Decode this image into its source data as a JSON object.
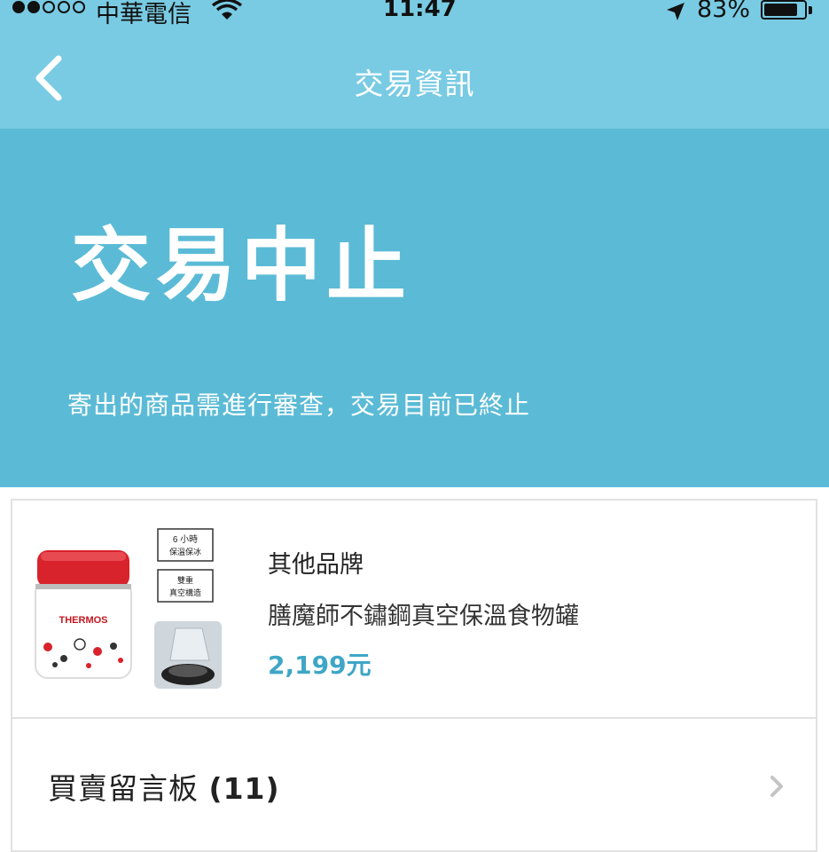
{
  "status_bar": {
    "carrier": "中華電信",
    "time": "11:47",
    "battery_percent": "83%",
    "battery_level": 0.83,
    "icons": [
      "signal-dots-icon",
      "wifi-icon",
      "location-arrow-icon",
      "battery-icon"
    ]
  },
  "nav": {
    "title": "交易資訊",
    "back_icon": "chevron-left-icon"
  },
  "hero": {
    "title": "交易中止",
    "subtitle": "寄出的商品需進行審查，交易目前已終止"
  },
  "product": {
    "brand": "其他品牌",
    "name": "膳魔師不鏽鋼真空保溫食物罐",
    "price": "2,199元",
    "image_labels": {
      "badge1_line1": "6 小時",
      "badge1_line2": "保溫保冰",
      "badge2_line1": "雙重",
      "badge2_line2": "真空構造",
      "logo": "THERMOS"
    }
  },
  "message_board": {
    "label": "買賣留言板",
    "count": "(11)",
    "chevron_icon": "chevron-right-icon"
  },
  "colors": {
    "nav_bg": "#79cbe3",
    "hero_bg": "#5bbbd6",
    "price": "#3fa6c6",
    "jar_lid": "#d8222c"
  }
}
